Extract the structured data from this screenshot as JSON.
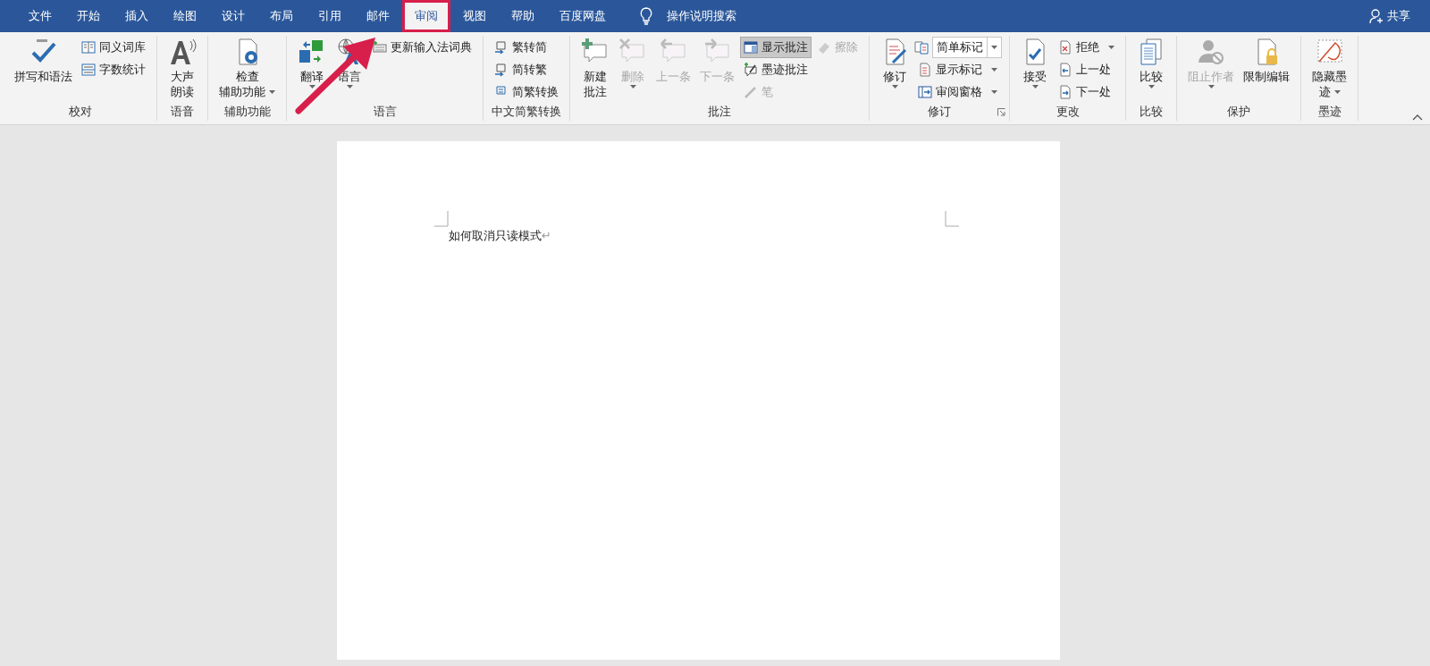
{
  "tabs": [
    {
      "label": "文件",
      "selected": false,
      "outlined": false
    },
    {
      "label": "开始",
      "selected": false,
      "outlined": false
    },
    {
      "label": "插入",
      "selected": false,
      "outlined": false
    },
    {
      "label": "绘图",
      "selected": false,
      "outlined": false
    },
    {
      "label": "设计",
      "selected": false,
      "outlined": false
    },
    {
      "label": "布局",
      "selected": false,
      "outlined": false
    },
    {
      "label": "引用",
      "selected": false,
      "outlined": false
    },
    {
      "label": "邮件",
      "selected": false,
      "outlined": false
    },
    {
      "label": "审阅",
      "selected": true,
      "outlined": true
    },
    {
      "label": "视图",
      "selected": false,
      "outlined": false
    },
    {
      "label": "帮助",
      "selected": false,
      "outlined": false
    },
    {
      "label": "百度网盘",
      "selected": false,
      "outlined": false
    }
  ],
  "tell_me": "操作说明搜索",
  "share": "共享",
  "groups": [
    {
      "label": "校对",
      "items": [
        {
          "kind": "large",
          "lines": [
            "拼写和语法"
          ]
        },
        {
          "kind": "stack",
          "items": [
            {
              "kind": "small",
              "label": "同义词库"
            },
            {
              "kind": "small",
              "label": "字数统计"
            }
          ]
        }
      ]
    },
    {
      "label": "语音",
      "items": [
        {
          "kind": "large",
          "lines": [
            "大声",
            "朗读"
          ]
        }
      ]
    },
    {
      "label": "辅助功能",
      "items": [
        {
          "kind": "large",
          "lines": [
            "检查",
            "辅助功能"
          ],
          "dropdown": true
        }
      ]
    },
    {
      "label": "语言",
      "items": [
        {
          "kind": "large",
          "lines": [
            "翻译"
          ],
          "dropdown": true
        },
        {
          "kind": "large",
          "lines": [
            "语言"
          ],
          "dropdown": true
        },
        {
          "kind": "stack",
          "items": [
            {
              "kind": "small",
              "label": "更新输入法词典"
            }
          ]
        }
      ]
    },
    {
      "label": "中文简繁转换",
      "items": [
        {
          "kind": "stack",
          "items": [
            {
              "kind": "small",
              "label": "繁转简"
            },
            {
              "kind": "small",
              "label": "简转繁"
            },
            {
              "kind": "small",
              "label": "简繁转换"
            }
          ]
        }
      ]
    },
    {
      "label": "批注",
      "items": [
        {
          "kind": "large",
          "lines": [
            "新建",
            "批注"
          ],
          "disabled": false
        },
        {
          "kind": "large",
          "lines": [
            "删除"
          ],
          "dropdown": true,
          "disabled": true
        },
        {
          "kind": "large",
          "lines": [
            "上一条"
          ],
          "disabled": true
        },
        {
          "kind": "large",
          "lines": [
            "下一条"
          ],
          "disabled": true
        },
        {
          "kind": "stack",
          "items": [
            {
              "kind": "small",
              "label": "显示批注",
              "selected": true,
              "disabled": false
            },
            {
              "kind": "small",
              "label": "墨迹批注",
              "selected": false,
              "disabled": false
            },
            {
              "kind": "small",
              "label": "笔",
              "selected": false,
              "disabled": true
            }
          ]
        },
        {
          "kind": "stack",
          "items": [
            {
              "kind": "small",
              "label": "擦除",
              "disabled": true
            }
          ]
        }
      ]
    },
    {
      "label": "修订",
      "launcher": true,
      "items": [
        {
          "kind": "large",
          "lines": [
            "修订"
          ],
          "dropdown": true
        },
        {
          "kind": "stack",
          "items": [
            {
              "kind": "select",
              "value": "简单标记"
            },
            {
              "kind": "small",
              "label": "显示标记",
              "dropdown": true
            },
            {
              "kind": "small",
              "label": "审阅窗格",
              "dropdown": true
            }
          ]
        }
      ]
    },
    {
      "label": "更改",
      "items": [
        {
          "kind": "large",
          "lines": [
            "接受"
          ],
          "dropdown": true
        },
        {
          "kind": "stack",
          "items": [
            {
              "kind": "small",
              "label": "拒绝",
              "dropdown": true
            },
            {
              "kind": "small",
              "label": "上一处"
            },
            {
              "kind": "small",
              "label": "下一处"
            }
          ]
        }
      ]
    },
    {
      "label": "比较",
      "items": [
        {
          "kind": "large",
          "lines": [
            "比较"
          ],
          "dropdown": true
        }
      ]
    },
    {
      "label": "保护",
      "items": [
        {
          "kind": "large",
          "lines": [
            "阻止作者"
          ],
          "dropdown": true,
          "disabled": true
        },
        {
          "kind": "large",
          "lines": [
            "限制编辑"
          ],
          "disabled": false
        }
      ]
    },
    {
      "label": "墨迹",
      "items": [
        {
          "kind": "large",
          "lines": [
            "隐藏墨",
            "迹"
          ],
          "dropdown": true
        }
      ]
    }
  ],
  "collapse_button": true,
  "document": {
    "paragraphs": [
      {
        "text": "如何取消只读模式",
        "mark": "↵"
      }
    ]
  },
  "annotations": [
    {
      "kind": "arrow"
    }
  ]
}
